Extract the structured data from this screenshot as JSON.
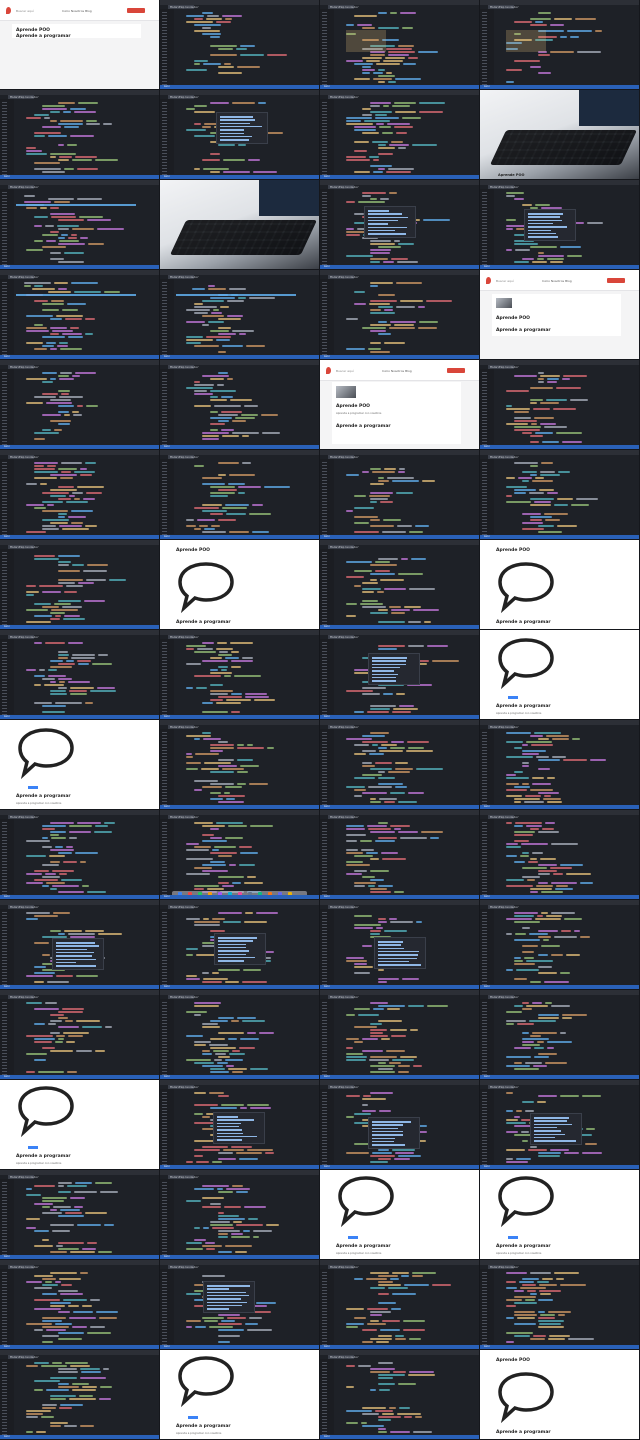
{
  "editor": {
    "tab_label": "ModelEmprendedor",
    "status_text": "main"
  },
  "site": {
    "search_placeholder": "Buscar aquí",
    "nav_links": "Inicio   Nosotros   Blog",
    "page_title": "Aprende POO",
    "section_title": "Aprende a programar",
    "body_text": "Aprende a programar con nosotros"
  },
  "frames": [
    {
      "kind": "browser",
      "variant": "plain"
    },
    {
      "kind": "editor",
      "variant": "code"
    },
    {
      "kind": "editor",
      "variant": "highlight"
    },
    {
      "kind": "editor",
      "variant": "highlight"
    },
    {
      "kind": "editor",
      "variant": "code"
    },
    {
      "kind": "editor",
      "variant": "popup"
    },
    {
      "kind": "editor",
      "variant": "code"
    },
    {
      "kind": "photo",
      "variant": "laptop"
    },
    {
      "kind": "editor",
      "variant": "class"
    },
    {
      "kind": "photo",
      "variant": "laptop-wide"
    },
    {
      "kind": "editor",
      "variant": "popup"
    },
    {
      "kind": "editor",
      "variant": "popup"
    },
    {
      "kind": "editor",
      "variant": "class"
    },
    {
      "kind": "editor",
      "variant": "class"
    },
    {
      "kind": "editor",
      "variant": "code"
    },
    {
      "kind": "browser",
      "variant": "thumb"
    },
    {
      "kind": "editor",
      "variant": "code"
    },
    {
      "kind": "editor",
      "variant": "code"
    },
    {
      "kind": "browser",
      "variant": "card"
    },
    {
      "kind": "editor",
      "variant": "code"
    },
    {
      "kind": "editor",
      "variant": "code"
    },
    {
      "kind": "editor",
      "variant": "code"
    },
    {
      "kind": "editor",
      "variant": "code"
    },
    {
      "kind": "editor",
      "variant": "code"
    },
    {
      "kind": "editor",
      "variant": "code"
    },
    {
      "kind": "bubble",
      "variant": "title-top"
    },
    {
      "kind": "editor",
      "variant": "code"
    },
    {
      "kind": "bubble",
      "variant": "title-top"
    },
    {
      "kind": "editor",
      "variant": "code"
    },
    {
      "kind": "editor",
      "variant": "code"
    },
    {
      "kind": "editor",
      "variant": "popup"
    },
    {
      "kind": "bubble",
      "variant": "title-bottom"
    },
    {
      "kind": "bubble",
      "variant": "title-bottom"
    },
    {
      "kind": "editor",
      "variant": "code"
    },
    {
      "kind": "editor",
      "variant": "code"
    },
    {
      "kind": "editor",
      "variant": "code"
    },
    {
      "kind": "editor",
      "variant": "code"
    },
    {
      "kind": "editor",
      "variant": "dock"
    },
    {
      "kind": "editor",
      "variant": "code"
    },
    {
      "kind": "editor",
      "variant": "code"
    },
    {
      "kind": "editor",
      "variant": "popup"
    },
    {
      "kind": "editor",
      "variant": "popup"
    },
    {
      "kind": "editor",
      "variant": "popup"
    },
    {
      "kind": "editor",
      "variant": "code"
    },
    {
      "kind": "editor",
      "variant": "code"
    },
    {
      "kind": "editor",
      "variant": "code"
    },
    {
      "kind": "editor",
      "variant": "code"
    },
    {
      "kind": "editor",
      "variant": "code"
    },
    {
      "kind": "bubble",
      "variant": "title-mid"
    },
    {
      "kind": "editor",
      "variant": "popup"
    },
    {
      "kind": "editor",
      "variant": "popup"
    },
    {
      "kind": "editor",
      "variant": "popup"
    },
    {
      "kind": "editor",
      "variant": "code"
    },
    {
      "kind": "editor",
      "variant": "code"
    },
    {
      "kind": "bubble",
      "variant": "title-mid"
    },
    {
      "kind": "bubble",
      "variant": "title-mid"
    },
    {
      "kind": "editor",
      "variant": "code"
    },
    {
      "kind": "editor",
      "variant": "popup"
    },
    {
      "kind": "editor",
      "variant": "code"
    },
    {
      "kind": "editor",
      "variant": "code"
    },
    {
      "kind": "editor",
      "variant": "code"
    },
    {
      "kind": "bubble",
      "variant": "title-mid"
    },
    {
      "kind": "editor",
      "variant": "code"
    },
    {
      "kind": "bubble",
      "variant": "title-top"
    }
  ]
}
